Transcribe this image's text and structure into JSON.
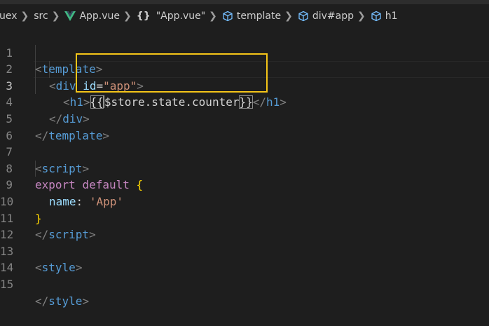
{
  "breadcrumb": {
    "items": [
      {
        "label": "uex",
        "icon": ""
      },
      {
        "label": "src",
        "icon": ""
      },
      {
        "label": "App.vue",
        "icon": "vue-icon"
      },
      {
        "label": "\"App.vue\"",
        "icon": "braces-icon",
        "prefix": "{}"
      },
      {
        "label": "template",
        "icon": "cube-icon"
      },
      {
        "label": "div#app",
        "icon": "cube-icon"
      },
      {
        "label": "h1",
        "icon": "cube-icon"
      }
    ]
  },
  "editor": {
    "active_line": 3,
    "line_numbers": [
      "1",
      "2",
      "3",
      "4",
      "5",
      "6",
      "7",
      "8",
      "9",
      "10",
      "11",
      "12",
      "13",
      "14",
      "15"
    ],
    "lines": {
      "l1": {
        "open": "<",
        "tag": "template",
        "close": ">"
      },
      "l2": {
        "open": "<",
        "tag": "div",
        "attr": "id",
        "eq": "=",
        "value": "\"app\"",
        "close": ">"
      },
      "l3": {
        "open": "<",
        "tag": "h1",
        "close": ">",
        "mustache_open": "{{",
        "expr": "$store.state.counter",
        "mustache_close": "}}",
        "end_open": "</",
        "end_tag": "h1",
        "end_close": ">"
      },
      "l4": {
        "open": "</",
        "tag": "div",
        "close": ">"
      },
      "l5": {
        "open": "</",
        "tag": "template",
        "close": ">"
      },
      "l7": {
        "open": "<",
        "tag": "script",
        "close": ">"
      },
      "l8": {
        "kw": "export",
        "kw2": "default",
        "brace": "{"
      },
      "l9": {
        "prop": "name",
        "colon": ":",
        "value": "'App'"
      },
      "l10": {
        "brace": "}"
      },
      "l11": {
        "open": "</",
        "tag": "script",
        "close": ">"
      },
      "l13": {
        "open": "<",
        "tag": "style",
        "close": ">"
      },
      "l15": {
        "open": "</",
        "tag": "style",
        "close": ">"
      }
    }
  },
  "colors": {
    "background": "#1e1e1e",
    "tag": "#569cd6",
    "attribute": "#9cdcfe",
    "string": "#ce9178",
    "keyword": "#c586c0",
    "brace": "#ffd700",
    "highlight_box": "#f5c518"
  }
}
